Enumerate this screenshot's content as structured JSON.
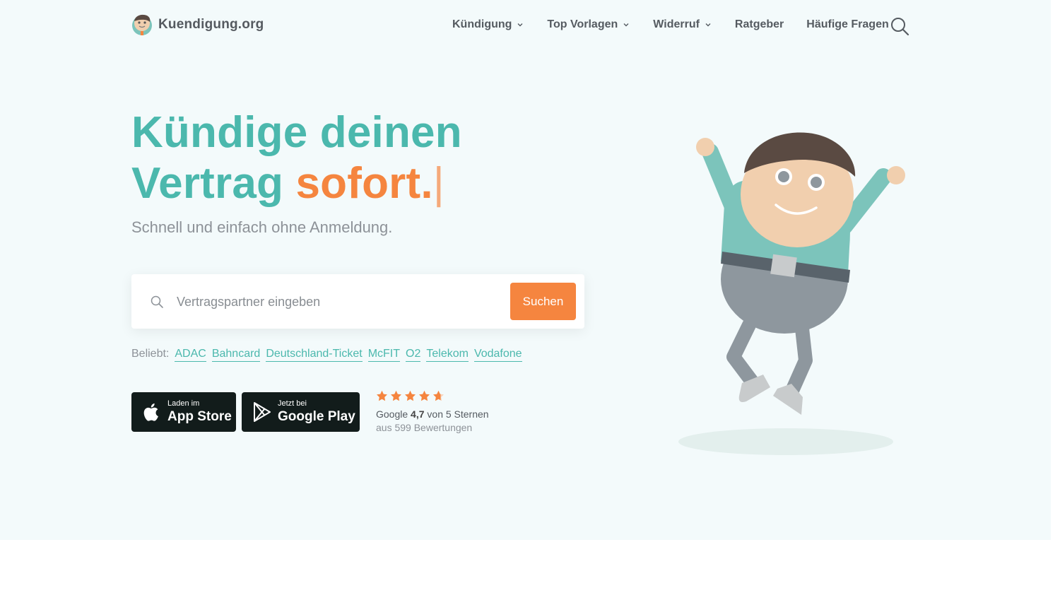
{
  "header": {
    "logo_text": "Kuendigung.org",
    "nav": [
      {
        "label": "Kündigung",
        "dropdown": true
      },
      {
        "label": "Top Vorlagen",
        "dropdown": true
      },
      {
        "label": "Widerruf",
        "dropdown": true
      },
      {
        "label": "Ratgeber",
        "dropdown": false
      },
      {
        "label": "Häufige Fragen",
        "dropdown": false
      }
    ],
    "search_icon": "search-icon"
  },
  "hero": {
    "headline_line1": "Kündige deinen",
    "headline_line2_start": "Vertrag ",
    "headline_line2_accent": "sofort.",
    "headline_caret": "|",
    "subline": "Schnell und einfach ohne Anmeldung."
  },
  "search": {
    "placeholder": "Vertragspartner eingeben",
    "value": "",
    "button_label": "Suchen"
  },
  "popular": {
    "label": "Beliebt:",
    "links": [
      "ADAC",
      "Bahncard",
      "Deutschland-Ticket",
      "McFIT",
      "O2",
      "Telekom",
      "Vodafone"
    ]
  },
  "stores": {
    "apple": {
      "small": "Laden im",
      "big": "App Store",
      "icon": "apple-icon"
    },
    "google": {
      "small": "Jetzt bei",
      "big": "Google Play",
      "icon": "google-play-icon"
    }
  },
  "rating": {
    "stars": 4.7,
    "prefix": "Google ",
    "score": "4,7",
    "suffix": " von 5 Sternen",
    "count_text": "aus 599 Bewertungen"
  },
  "colors": {
    "accent_teal": "#4bb8ad",
    "accent_orange": "#f5853f",
    "hero_bg": "#f3fafb"
  }
}
